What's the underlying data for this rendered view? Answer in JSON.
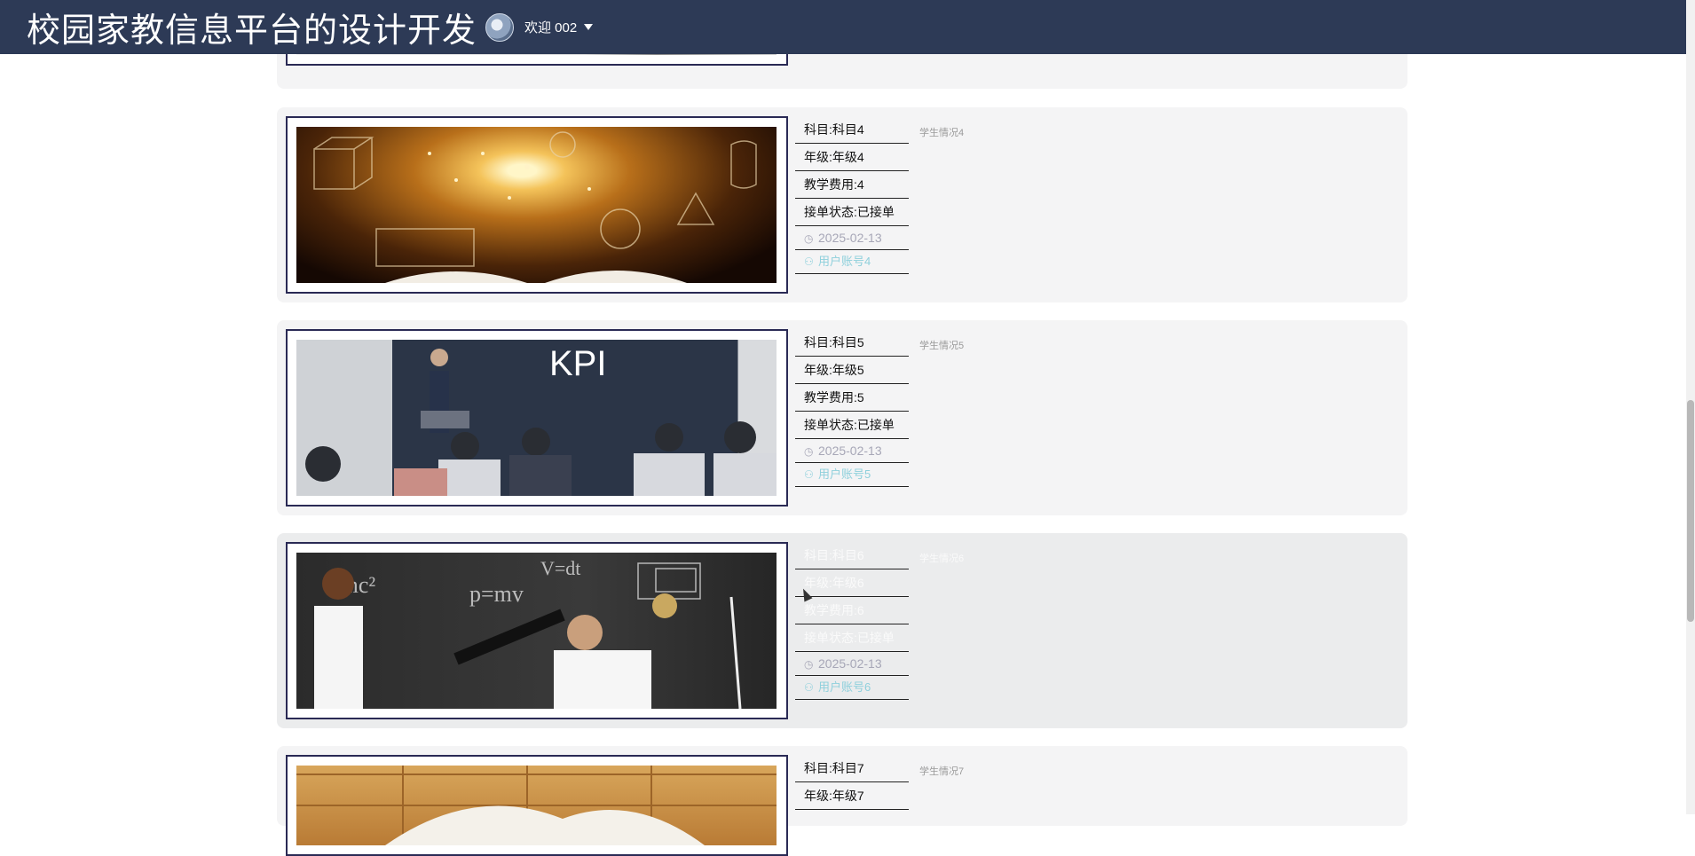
{
  "header": {
    "app_title": "校园家教信息平台的设计开发",
    "welcome_text": "欢迎 002"
  },
  "cards": [
    {
      "subject": "科目:科目4",
      "grade": "年级:年级4",
      "fee": "教学费用:4",
      "status": "接单状态:已接单",
      "date": "2025-02-13",
      "user": "用户账号4",
      "desc": "学生情况4"
    },
    {
      "subject": "科目:科目5",
      "grade": "年级:年级5",
      "fee": "教学费用:5",
      "status": "接单状态:已接单",
      "date": "2025-02-13",
      "user": "用户账号5",
      "desc": "学生情况5"
    },
    {
      "subject": "科目:科目6",
      "grade": "年级:年级6",
      "fee": "教学费用:6",
      "status": "接单状态:已接单",
      "date": "2025-02-13",
      "user": "用户账号6",
      "desc": "学生情况6"
    },
    {
      "subject": "科目:科目7",
      "grade": "年级:年级7",
      "desc": "学生情况7"
    }
  ],
  "icons": {
    "clock": "clock-icon",
    "user": "user-icon",
    "caret": "caret-down-icon"
  },
  "colors": {
    "header_bg": "#2d3a56",
    "card_bg": "#f4f4f5",
    "user_link": "#8fd0dc"
  }
}
